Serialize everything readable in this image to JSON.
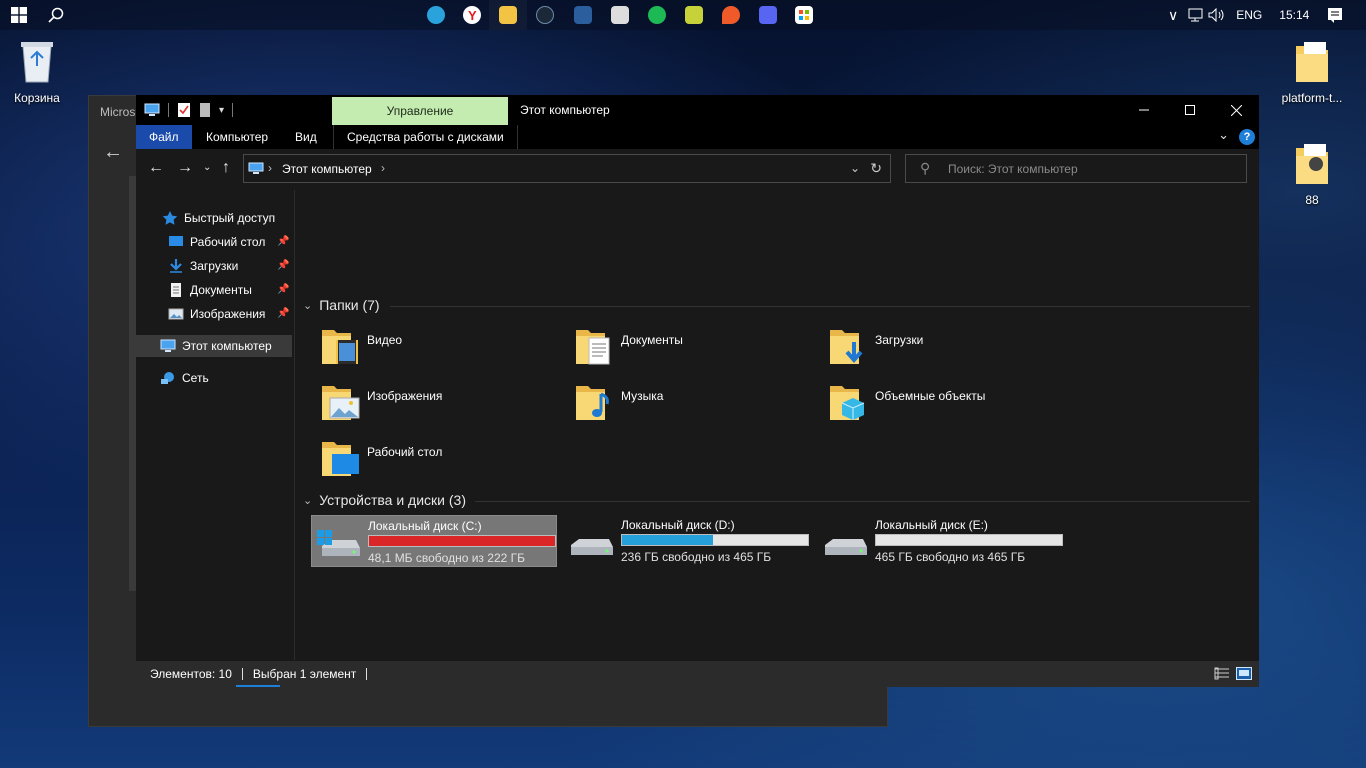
{
  "desktop": {
    "icons": [
      {
        "label": "Корзина"
      },
      {
        "label": "platform-t..."
      },
      {
        "label": "88"
      }
    ]
  },
  "taskbar": {
    "tray": {
      "language": "ENG",
      "time": "15:14"
    }
  },
  "background_window": {
    "title": "Micros"
  },
  "explorer": {
    "title": "Этот компьютер",
    "context_tab": "Управление",
    "ribbon_tabs": [
      "Файл",
      "Компьютер",
      "Вид",
      "Средства работы с дисками"
    ],
    "help": "?",
    "address": {
      "crumb": "Этот компьютер"
    },
    "search": {
      "placeholder": "Поиск: Этот компьютер"
    },
    "sidebar": {
      "quick_access": "Быстрый доступ",
      "pinned": [
        "Рабочий стол",
        "Загрузки",
        "Документы",
        "Изображения"
      ],
      "this_pc": "Этот компьютер",
      "network": "Сеть"
    },
    "folders_header": "Папки (7)",
    "folders": [
      {
        "name": "Видео",
        "icon": "video-folder-icon"
      },
      {
        "name": "Документы",
        "icon": "documents-folder-icon"
      },
      {
        "name": "Загрузки",
        "icon": "downloads-folder-icon"
      },
      {
        "name": "Изображения",
        "icon": "pictures-folder-icon"
      },
      {
        "name": "Музыка",
        "icon": "music-folder-icon"
      },
      {
        "name": "Объемные объекты",
        "icon": "3d-objects-folder-icon"
      },
      {
        "name": "Рабочий стол",
        "icon": "desktop-folder-icon"
      }
    ],
    "devices_header": "Устройства и диски (3)",
    "drives": [
      {
        "name": "Локальный диск (C:)",
        "free": "48,1 МБ свободно из 222 ГБ",
        "used_fraction": 0.9998,
        "bar_color": "#da2626",
        "selected": true
      },
      {
        "name": "Локальный диск (D:)",
        "free": "236 ГБ свободно из 465 ГБ",
        "used_fraction": 0.49,
        "bar_color": "#26a0da",
        "selected": false
      },
      {
        "name": "Локальный диск (E:)",
        "free": "465 ГБ свободно из 465 ГБ",
        "used_fraction": 0.0,
        "bar_color": "#26a0da",
        "selected": false
      }
    ],
    "status": {
      "items": "Элементов: 10",
      "selected": "Выбран 1 элемент"
    }
  }
}
